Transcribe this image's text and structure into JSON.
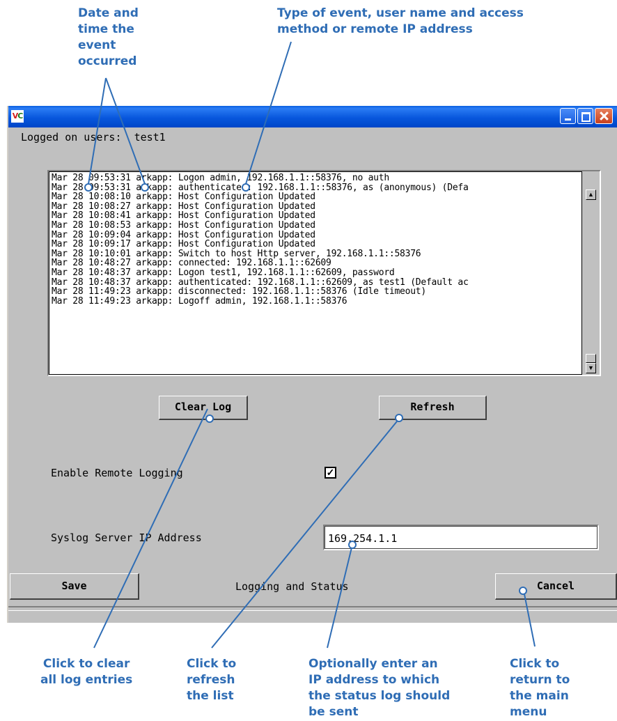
{
  "annotations": {
    "date_time": [
      "Date and",
      "time the",
      "event",
      "occurred"
    ],
    "event_type": [
      "Type of event, user name and access",
      "method or remote IP address"
    ],
    "clear_all": [
      "Click to clear",
      "all log entries"
    ],
    "refresh_list": [
      "Click to",
      "refresh",
      "the list"
    ],
    "ip_address": [
      "Optionally enter an",
      "IP address to which",
      "the status log should",
      "be sent"
    ],
    "return_menu": [
      "Click to",
      "return to",
      "the main",
      "menu"
    ]
  },
  "window": {
    "logo_left": "V",
    "logo_right": "C"
  },
  "logged_on": {
    "label": "Logged on users:",
    "value": "test1"
  },
  "log": {
    "lines": [
      "Mar 28 09:53:31 arkapp: Logon admin, 192.168.1.1::58376, no auth",
      "Mar 28 09:53:31 arkapp: authenticated: 192.168.1.1::58376, as (anonymous) (Defa",
      "Mar 28 10:08:10 arkapp: Host Configuration Updated",
      "Mar 28 10:08:27 arkapp: Host Configuration Updated",
      "Mar 28 10:08:41 arkapp: Host Configuration Updated",
      "Mar 28 10:08:53 arkapp: Host Configuration Updated",
      "Mar 28 10:09:04 arkapp: Host Configuration Updated",
      "Mar 28 10:09:17 arkapp: Host Configuration Updated",
      "Mar 28 10:10:01 arkapp: Switch to host Http server, 192.168.1.1::58376",
      "Mar 28 10:48:27 arkapp: connected: 192.168.1.1::62609",
      "Mar 28 10:48:37 arkapp: Logon test1, 192.168.1.1::62609, password",
      "Mar 28 10:48:37 arkapp: authenticated: 192.168.1.1::62609, as test1 (Default ac",
      "Mar 28 11:49:23 arkapp: disconnected: 192.168.1.1::58376 (Idle timeout)",
      "Mar 28 11:49:23 arkapp: Logoff admin, 192.168.1.1::58376"
    ]
  },
  "buttons": {
    "clear_log": "Clear Log",
    "refresh": "Refresh",
    "save": "Save",
    "cancel": "Cancel"
  },
  "remote_logging": {
    "label": "Enable Remote Logging",
    "checked": true
  },
  "syslog": {
    "label": "Syslog Server IP Address",
    "value": "169.254.1.1"
  },
  "footer": {
    "title": "Logging and Status"
  },
  "colors": {
    "callout": "#2f6db5",
    "window_bg": "#c0c0c0",
    "titlebar": "#0857dd"
  }
}
